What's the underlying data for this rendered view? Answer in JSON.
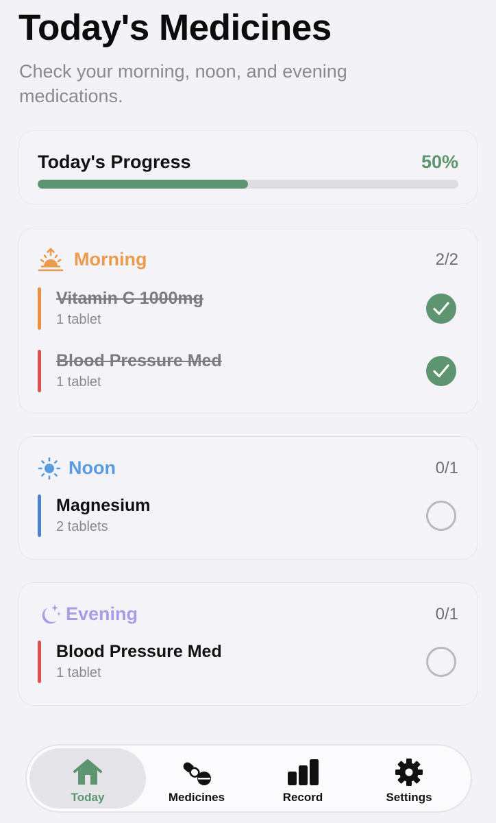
{
  "header": {
    "title": "Today's Medicines",
    "subtitle": "Check your morning, noon, and evening medications."
  },
  "progress": {
    "label": "Today's Progress",
    "percent_text": "50%",
    "value": 0.5,
    "color": "#5e9470"
  },
  "sections": [
    {
      "title": "Morning",
      "count": "2/2",
      "color": "#ec9a4b",
      "icon": "sunrise-icon",
      "meds": [
        {
          "name": "Vitamin C 1000mg",
          "dose": "1 tablet",
          "done": true,
          "color": "#e8913f"
        },
        {
          "name": "Blood Pressure Med",
          "dose": "1 tablet",
          "done": true,
          "color": "#d9534f"
        }
      ]
    },
    {
      "title": "Noon",
      "count": "0/1",
      "color": "#5a9be0",
      "icon": "sun-icon",
      "meds": [
        {
          "name": "Magnesium",
          "dose": "2 tablets",
          "done": false,
          "color": "#4e82d1"
        }
      ]
    },
    {
      "title": "Evening",
      "count": "0/1",
      "color": "#a99be6",
      "icon": "moon-stars-icon",
      "meds": [
        {
          "name": "Blood Pressure Med",
          "dose": "1 tablet",
          "done": false,
          "color": "#d9534f"
        }
      ]
    }
  ],
  "tabbar": {
    "tabs": [
      {
        "label": "Today",
        "icon": "home-icon",
        "active": true
      },
      {
        "label": "Medicines",
        "icon": "pills-icon",
        "active": false
      },
      {
        "label": "Record",
        "icon": "bar-chart-icon",
        "active": false
      },
      {
        "label": "Settings",
        "icon": "gear-icon",
        "active": false
      }
    ]
  }
}
